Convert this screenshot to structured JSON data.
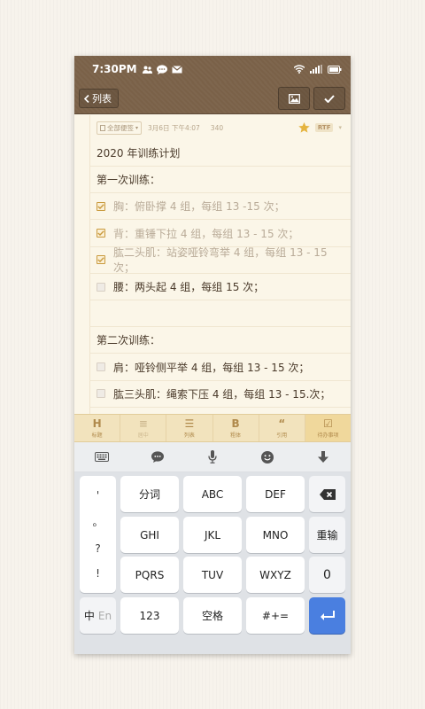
{
  "status": {
    "time": "7:30PM"
  },
  "toolbar": {
    "back_label": "列表"
  },
  "note": {
    "tag_label": "全部便签",
    "date": "3月6日 下午4:07",
    "count": "340",
    "format_badge": "RTF",
    "lines": [
      {
        "text": "2020 年训练计划",
        "type": "text"
      },
      {
        "text": "第一次训练：",
        "type": "text"
      },
      {
        "text": "胸：俯卧撑 4 组，每组 13 -15 次；",
        "type": "check",
        "checked": true
      },
      {
        "text": "背：重锤下拉 4 组，每组 13 - 15 次；",
        "type": "check",
        "checked": true
      },
      {
        "text": "肱二头肌：站姿哑铃弯举 4 组，每组 13 - 15 次；",
        "type": "check",
        "checked": true
      },
      {
        "text": "腰：两头起 4 组，每组 15 次；",
        "type": "check",
        "checked": false
      },
      {
        "text": "",
        "type": "text"
      },
      {
        "text": "第二次训练：",
        "type": "text"
      },
      {
        "text": "肩：哑铃侧平举 4 组，每组 13 - 15 次；",
        "type": "check",
        "checked": false
      },
      {
        "text": "肱三头肌：绳索下压 4 组，每组 13 - 15.次；",
        "type": "check",
        "checked": false
      }
    ]
  },
  "format_bar": [
    {
      "glyph": "H",
      "label": "标题"
    },
    {
      "glyph": "≡",
      "label": "居中"
    },
    {
      "glyph": "☰",
      "label": "列表"
    },
    {
      "glyph": "B",
      "label": "粗体"
    },
    {
      "glyph": "“",
      "label": "引用"
    },
    {
      "glyph": "☑",
      "label": "待办事项"
    }
  ],
  "keyboard": {
    "punct": [
      "'",
      "。",
      "?",
      "!"
    ],
    "row1": [
      "分词",
      "ABC",
      "DEF"
    ],
    "row2": [
      "GHI",
      "JKL",
      "MNO",
      "重输"
    ],
    "row3": [
      "PQRS",
      "TUV",
      "WXYZ",
      "0"
    ],
    "lang_cn": "中",
    "lang_en": "En",
    "num": "123",
    "space": "空格",
    "sym": "#+="
  }
}
